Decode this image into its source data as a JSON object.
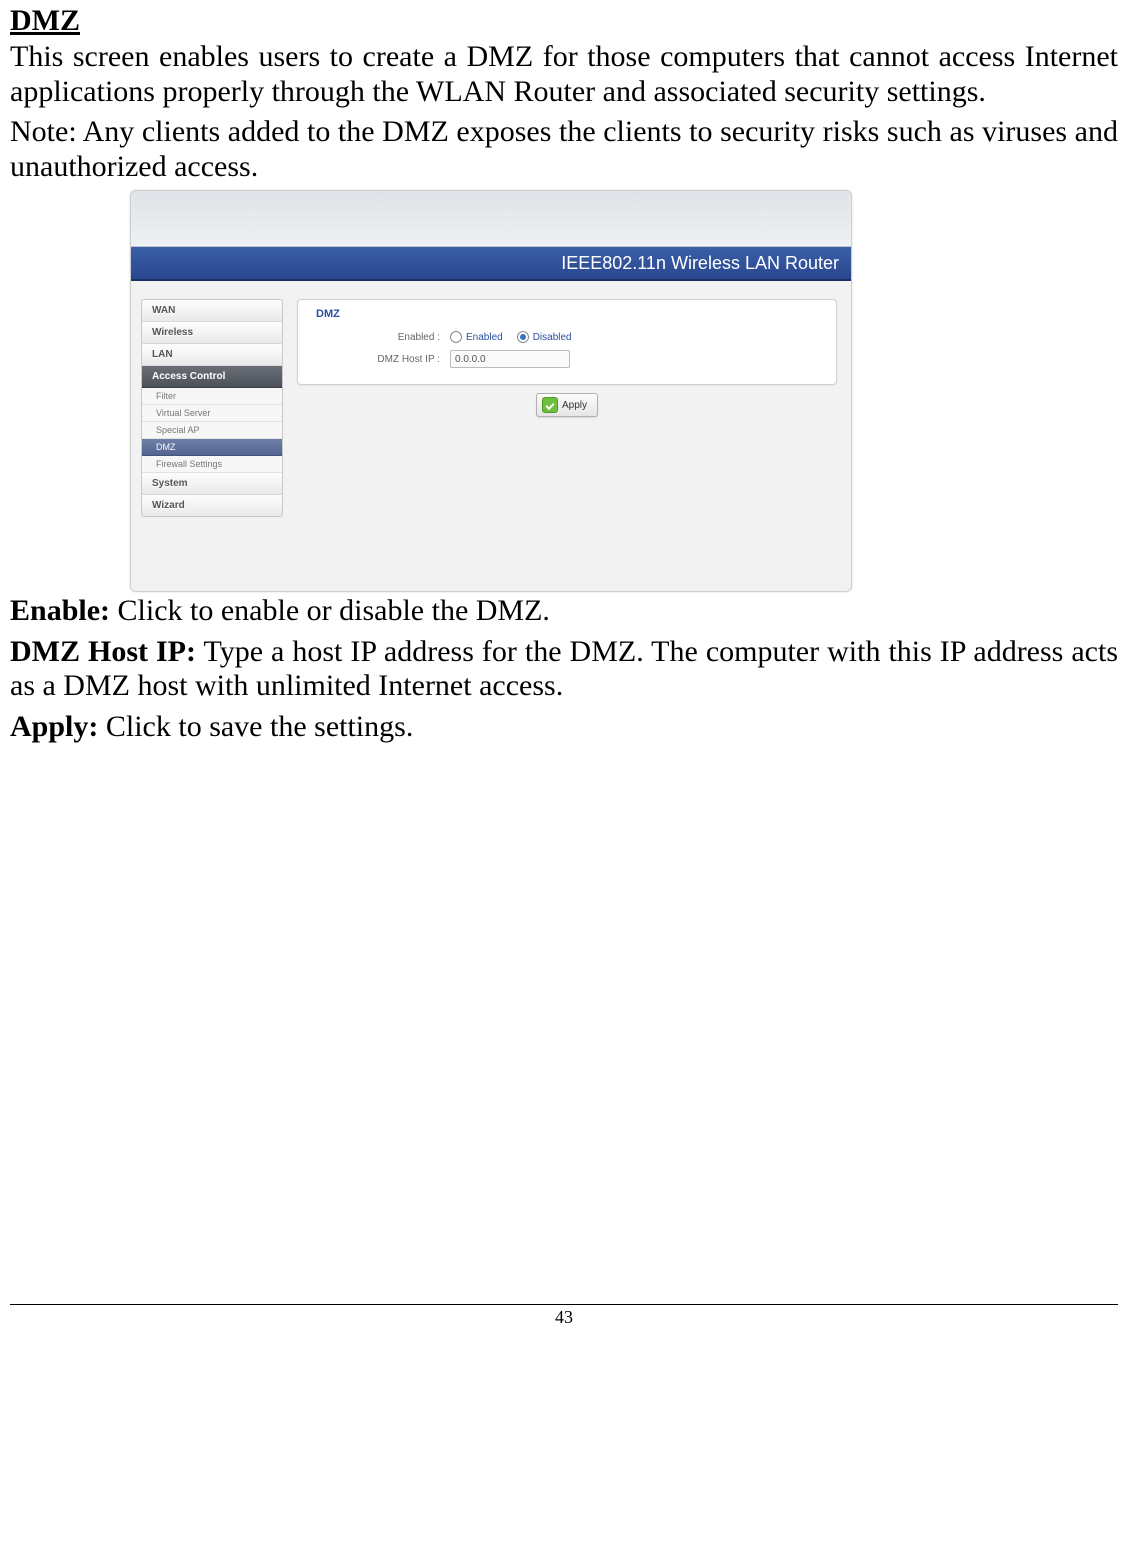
{
  "doc": {
    "heading": "DMZ",
    "para1": "This screen enables users to create a DMZ for those computers that cannot access Internet applications properly through the WLAN Router and associated security settings.",
    "para2": "Note: Any clients added to the DMZ exposes the clients to security risks such as viruses and unauthorized access.",
    "enable_label": "Enable:",
    "enable_desc": " Click to enable or disable the DMZ.",
    "hostip_label": "DMZ Host IP:",
    "hostip_desc": " Type a host IP address for the DMZ. The computer with this IP address acts as a DMZ host with unlimited Internet access.",
    "apply_label": "Apply:",
    "apply_desc": " Click to save the settings.",
    "page_number": "43"
  },
  "router": {
    "title": "IEEE802.11n  Wireless LAN Router",
    "nav": {
      "wan": "WAN",
      "wireless": "Wireless",
      "lan": "LAN",
      "access_control": "Access Control",
      "filter": "Filter",
      "virtual_server": "Virtual Server",
      "special_ap": "Special AP",
      "dmz": "DMZ",
      "firewall": "Firewall Settings",
      "system": "System",
      "wizard": "Wizard"
    },
    "panel": {
      "title": "DMZ",
      "enabled_label": "Enabled :",
      "enabled_opt": "Enabled",
      "disabled_opt": "Disabled",
      "hostip_label": "DMZ Host IP :",
      "hostip_value": "0.0.0.0",
      "apply": "Apply"
    }
  }
}
